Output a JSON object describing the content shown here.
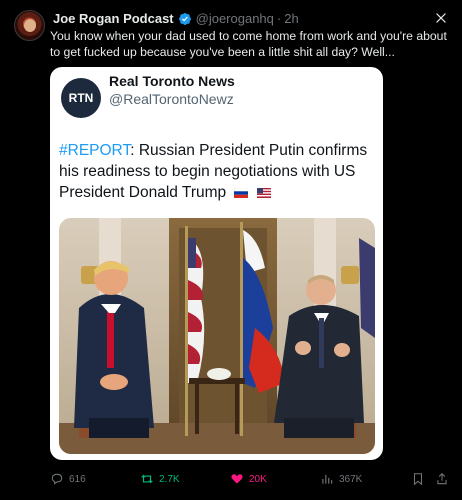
{
  "tweet": {
    "author_name": "Joe Rogan Podcast",
    "handle": "@joeroganhq",
    "separator": "·",
    "time": "2h",
    "text": "You know when your dad used to come home from work and you're about to get fucked up because you've been a little shit all day? Well..."
  },
  "quote": {
    "logo_text": "RTN",
    "name": "Real Toronto News",
    "handle": "@RealTorontoNewz",
    "hashtag": "#REPORT",
    "text": ": Russian President Putin confirms his readiness to begin negotiations with US President Donald Trump"
  },
  "actions": {
    "replies": "616",
    "reposts": "2.7K",
    "likes": "20K",
    "views": "367K"
  },
  "colors": {
    "repost": "#00ba7c",
    "like": "#f91880",
    "muted": "#71767b",
    "link": "#1d9bf0"
  }
}
